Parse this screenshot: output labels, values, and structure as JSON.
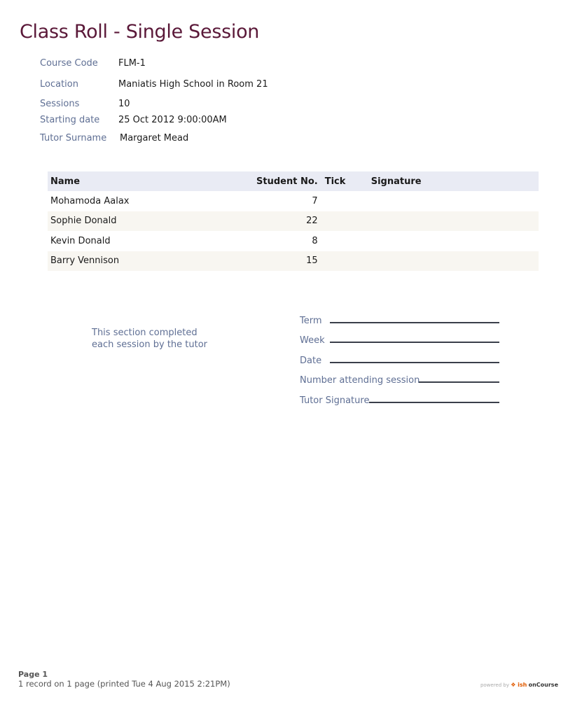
{
  "title": "Class Roll - Single Session",
  "info": {
    "course_code_label": "Course Code",
    "course_code": "FLM-1",
    "location_label": "Location",
    "location": "Maniatis High School in Room 21",
    "sessions_label": "Sessions",
    "sessions": "10",
    "start_label": "Starting date",
    "start": "25 Oct 2012 9:00:00AM",
    "tutor_label": "Tutor Surname",
    "tutor": "Margaret Mead"
  },
  "table": {
    "headers": {
      "name": "Name",
      "student_no": "Student No.",
      "tick": "Tick",
      "signature": "Signature"
    },
    "rows": [
      {
        "name": "Mohamoda Aalax",
        "student_no": "7"
      },
      {
        "name": "Sophie Donald",
        "student_no": "22"
      },
      {
        "name": "Kevin Donald",
        "student_no": "8"
      },
      {
        "name": "Barry Vennison",
        "student_no": "15"
      }
    ]
  },
  "note": {
    "line1": "This section completed",
    "line2": "each session by the tutor"
  },
  "signoff": {
    "term": "Term",
    "week": "Week",
    "date": "Date",
    "attending": "Number attending session",
    "tutor_signature": "Tutor Signature"
  },
  "footer": {
    "page": "Page 1",
    "info": "1 record on 1 page (printed Tue 4 Aug 2015 2:21PM)",
    "powered": "powered by",
    "brand_mark": "❖ ish",
    "brand_name": "onCourse"
  }
}
